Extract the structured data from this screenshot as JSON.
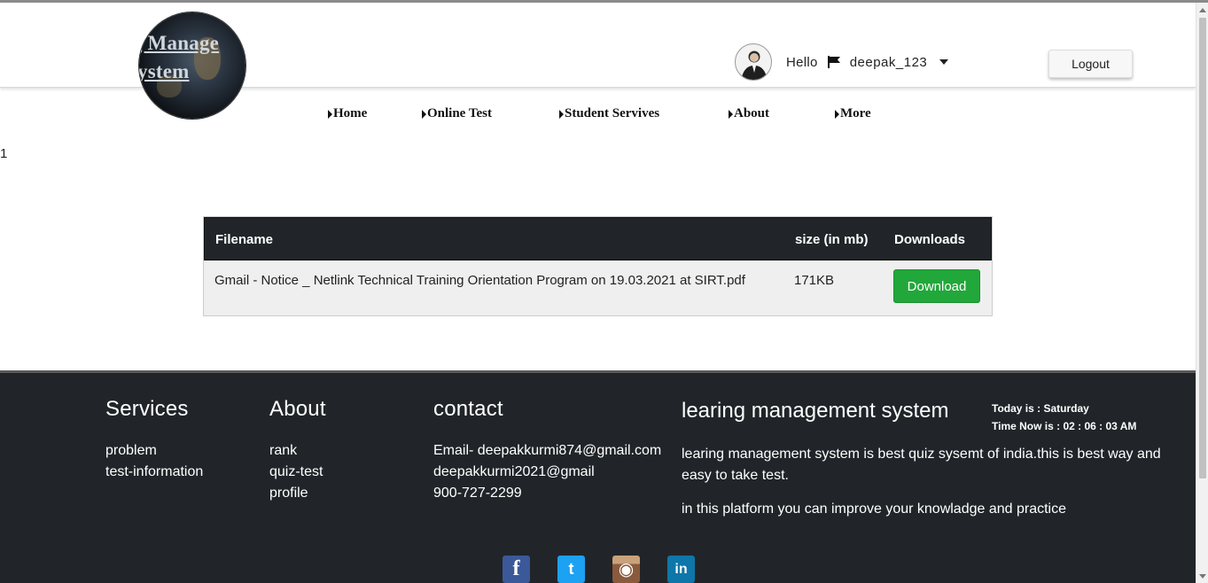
{
  "logo": {
    "line1": "g  Manage",
    "line2": "ystem"
  },
  "user": {
    "greeting": "Hello",
    "username": "deepak_123"
  },
  "header": {
    "logout_label": "Logout"
  },
  "nav": {
    "items": [
      {
        "label": "Home"
      },
      {
        "label": "Online Test"
      },
      {
        "label": "Student Servives"
      },
      {
        "label": "About"
      },
      {
        "label": "More"
      }
    ]
  },
  "stray_text": "1",
  "table": {
    "headers": {
      "filename": "Filename",
      "size": "size (in mb)",
      "downloads": "Downloads"
    },
    "rows": [
      {
        "filename": "Gmail - Notice _ Netlink Technical Training Orientation Program on 19.03.2021 at SIRT.pdf",
        "size": "171KB",
        "button": "Download"
      }
    ]
  },
  "footer": {
    "services": {
      "title": "Services",
      "links": [
        "problem",
        "test-information"
      ]
    },
    "about": {
      "title": "About",
      "links": [
        "rank",
        "quiz-test",
        "profile"
      ]
    },
    "contact": {
      "title": "contact",
      "lines": [
        "Email- deepakkurmi874@gmail.com",
        "deepakkurmi2021@gmail",
        "900-727-2299"
      ]
    },
    "lms": {
      "title": "learing management system",
      "today": "Today is : Saturday",
      "time": "Time Now is : 02 : 06 : 03 AM",
      "desc1": "learing management system is best quiz sysemt of india.this is best way and easy to take test.",
      "desc2": "in this platform you can improve your knowladge and practice"
    },
    "social": [
      {
        "icon": "facebook-icon",
        "glyph": "f",
        "color": "#3b5998"
      },
      {
        "icon": "twitter-icon",
        "glyph": "t",
        "color": "#1da1f2"
      },
      {
        "icon": "instagram-icon",
        "glyph": "◉",
        "color": "#8a5a3c"
      },
      {
        "icon": "linkedin-icon",
        "glyph": "in",
        "color": "#0e76a8"
      }
    ]
  },
  "colors": {
    "header_bg": "#ffffff",
    "footer_bg": "#212529",
    "download_green": "#22a73a",
    "table_head": "#212529"
  }
}
